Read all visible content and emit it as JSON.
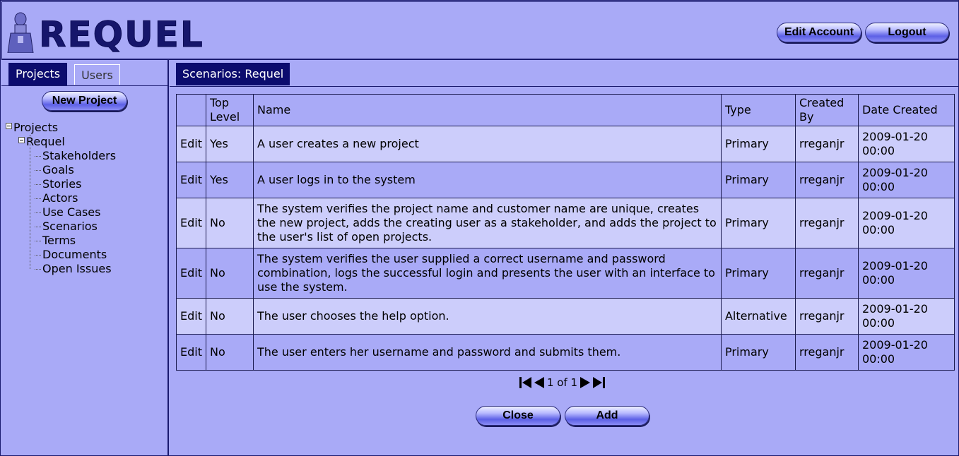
{
  "app": {
    "logo_text": "REQUEL"
  },
  "header": {
    "edit_account_label": "Edit Account",
    "logout_label": "Logout"
  },
  "left_tabs": {
    "projects": "Projects",
    "users": "Users"
  },
  "left": {
    "new_project_label": "New Project"
  },
  "tree": {
    "root": "Projects",
    "project": "Requel",
    "items": [
      "Stakeholders",
      "Goals",
      "Stories",
      "Actors",
      "Use Cases",
      "Scenarios",
      "Terms",
      "Documents",
      "Open Issues"
    ]
  },
  "main": {
    "tab_label": "Scenarios: Requel"
  },
  "table": {
    "headers": {
      "top_level": "Top Level",
      "name": "Name",
      "type": "Type",
      "created_by": "Created By",
      "date_created": "Date Created"
    },
    "rows": [
      {
        "edit": "Edit",
        "top": "Yes",
        "name": "A user creates a new project",
        "type": "Primary",
        "by": "rreganjr",
        "date": "2009-01-20 00:00"
      },
      {
        "edit": "Edit",
        "top": "Yes",
        "name": "A user logs in to the system",
        "type": "Primary",
        "by": "rreganjr",
        "date": "2009-01-20 00:00"
      },
      {
        "edit": "Edit",
        "top": "No",
        "name": "The system verifies the project name and customer name are unique, creates the new project, adds the creating user as a stakeholder, and adds the project to the user's list of open projects.",
        "type": "Primary",
        "by": "rreganjr",
        "date": "2009-01-20 00:00"
      },
      {
        "edit": "Edit",
        "top": "No",
        "name": "The system verifies the user supplied a correct username and password combination, logs the successful login and presents the user with an interface to use the system.",
        "type": "Primary",
        "by": "rreganjr",
        "date": "2009-01-20 00:00"
      },
      {
        "edit": "Edit",
        "top": "No",
        "name": "The user chooses the help option.",
        "type": "Alternative",
        "by": "rreganjr",
        "date": "2009-01-20 00:00"
      },
      {
        "edit": "Edit",
        "top": "No",
        "name": "The user enters her username and password and submits them.",
        "type": "Primary",
        "by": "rreganjr",
        "date": "2009-01-20 00:00"
      }
    ]
  },
  "pager": {
    "text": "1 of 1"
  },
  "actions": {
    "close_label": "Close",
    "add_label": "Add"
  },
  "colors": {
    "background": "#a9aaf7",
    "dark_blue": "#0c0c6e",
    "row_light": "#cccdfb"
  }
}
